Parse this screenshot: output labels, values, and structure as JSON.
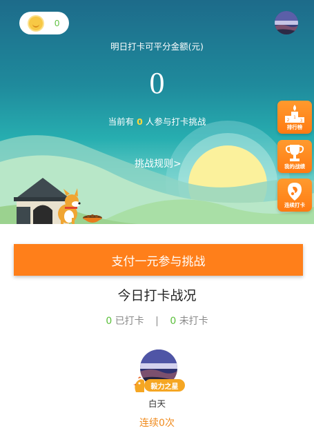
{
  "header": {
    "coin_count": "0",
    "subtitle": "明日打卡可平分金额(元)",
    "amount": "0",
    "participants_prefix": "当前有 ",
    "participants_count": "0",
    "participants_suffix": " 人参与打卡挑战",
    "rules_link": "挑战规则>"
  },
  "side_menu": [
    {
      "label": "排行榜",
      "icon": "podium-icon"
    },
    {
      "label": "我的战绩",
      "icon": "trophy-icon"
    },
    {
      "label": "连续打卡",
      "icon": "streak-icon"
    }
  ],
  "pay_button": "支付一元参与挑战",
  "today": {
    "title": "今日打卡战况",
    "checked_count": "0",
    "checked_label": "已打卡",
    "separator": "|",
    "unchecked_count": "0",
    "unchecked_label": "未打卡"
  },
  "user": {
    "badge": "毅力之星",
    "name": "白天",
    "streak": "连续0次"
  },
  "colors": {
    "accent_orange": "#ff7f1a",
    "count_green": "#5abf3a",
    "streak_orange": "#f08a1c"
  }
}
